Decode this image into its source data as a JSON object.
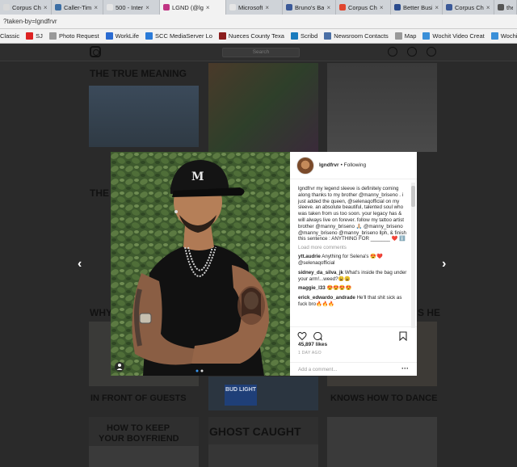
{
  "tabs": [
    {
      "label": "Corpus Ch",
      "color": "#d9d9d9",
      "active": false
    },
    {
      "label": "Caller-Tim",
      "color": "#3b6ea5",
      "active": false
    },
    {
      "label": "500 - Inter",
      "color": "#e5e5e5",
      "active": false
    },
    {
      "label": "LGND (@lg",
      "color": "#c13584",
      "active": true
    },
    {
      "label": "Microsoft",
      "color": "#e5e5e5",
      "active": false
    },
    {
      "label": "Bruno's Ba",
      "color": "#3b5998",
      "active": false
    },
    {
      "label": "Corpus Ch",
      "color": "#e0452e",
      "active": false
    },
    {
      "label": "Better Busi",
      "color": "#2a4b8d",
      "active": false
    },
    {
      "label": "Corpus Ch",
      "color": "#3b5998",
      "active": false
    },
    {
      "label": "the C",
      "color": "#555555",
      "active": false
    }
  ],
  "url": "?taken-by=lgndfrvr",
  "bookmarks": [
    {
      "label": "Classic",
      "color": "#f2f2f2"
    },
    {
      "label": "SJ",
      "color": "#d22"
    },
    {
      "label": "Photo Request",
      "color": "#999"
    },
    {
      "label": "WorkLife",
      "color": "#2a6bd1"
    },
    {
      "label": "SCC MediaServer Lo",
      "color": "#2b7bd8"
    },
    {
      "label": "Nueces County Texa",
      "color": "#8b1d1d"
    },
    {
      "label": "Scribd",
      "color": "#1a7bbd"
    },
    {
      "label": "Newsroom Contacts",
      "color": "#4a6fa5"
    },
    {
      "label": "Map",
      "color": "#999"
    },
    {
      "label": "Wochit Video Creat",
      "color": "#3a8fd8"
    },
    {
      "label": "Wochit Video Creat",
      "color": "#3a8fd8"
    }
  ],
  "background_page": {
    "search_placeholder": "Search",
    "headlines": {
      "true_meaning": "THE TRUE MEANING",
      "the_partial": "THE",
      "why_partial": "WHY",
      "s_he": "S HE",
      "in_front": "IN FRONT OF GUESTS",
      "knows": "KNOWS HOW TO DANCE",
      "keep_line1": "HOW TO KEEP",
      "keep_line2": "YOUR BOYFRIEND",
      "ghost": "GHOST CAUGHT",
      "bud": "BUD LIGHT"
    }
  },
  "nav": {
    "prev": "‹",
    "next": "›"
  },
  "post": {
    "username": "lgndfrvr",
    "follow_state": "• Following",
    "caption_text": "lgndfrvr my legend sleeve is definitely coming along thanks to my brother @manny_briseno . i just added the queen, @selenaqofficial on my sleeve. an absolute beautiful, talented soul who was taken from us too soon. your legacy has & will always live on forever. follow my tattoo artist brother @manny_briseno 🙏🏼 @manny_briseno @manny_briseno @manny_briseno llph, & finish this sentence : ANYTHING FOR _______ ❤️ ℹ️",
    "load_more": "Load more comments",
    "comments": [
      {
        "user": "ytt.audrie",
        "text": "Anything for Selena's 😍❤️ @selenaqofficial"
      },
      {
        "user": "sidney_da_silva_jk",
        "text": "What's inside the bag under your arm!...weed?😩😩"
      },
      {
        "user": "maggie_l33",
        "text": "😍😍😍😍"
      },
      {
        "user": "erick_edwardo_andrade",
        "text": "He'll that shit sick as fuck bro🔥🔥🔥"
      }
    ],
    "likes": "45,897 likes",
    "time_ago": "1 DAY AGO",
    "add_comment_placeholder": "Add a comment...",
    "more_options": "···"
  }
}
